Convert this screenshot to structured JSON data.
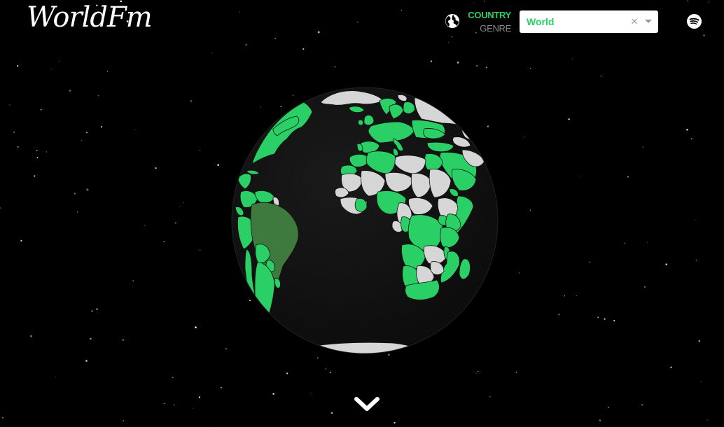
{
  "header": {
    "logo_text": "WorldFm"
  },
  "mode_toggle": {
    "country_label": "COUNTRY",
    "genre_label": "GENRE",
    "active": "country",
    "icon": "globe-icon"
  },
  "selector": {
    "value": "World",
    "clear_symbol": "×",
    "arrow_icon": "caret-down-icon"
  },
  "spotify": {
    "icon": "spotify-icon"
  },
  "globe": {
    "highlighted_country": "Brazil",
    "colors": {
      "ocean": "#111111",
      "available_country": "#2ad066",
      "unavailable_country": "#d6d6d6",
      "selected_country": "#3e7a3e",
      "border": "#111111"
    }
  },
  "scroll": {
    "icon": "chevron-down-icon"
  },
  "colors": {
    "background": "#000000",
    "accent": "#2ad066",
    "inactive_text": "#888888"
  }
}
